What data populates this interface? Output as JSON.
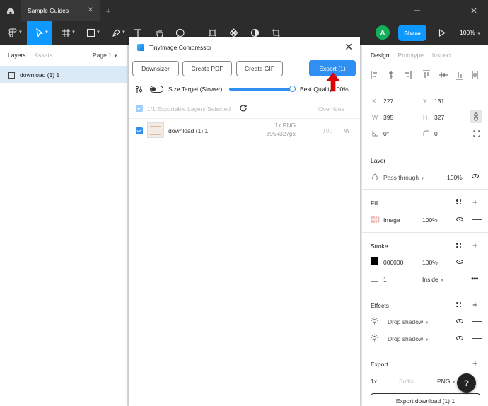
{
  "tabbar": {
    "active_tab": "Sample Guides",
    "close_glyph": "✕",
    "plus_glyph": "+"
  },
  "toolbar": {
    "avatar_initial": "A",
    "share_label": "Share",
    "zoom": "100%"
  },
  "left_panel": {
    "tabs": [
      "Layers",
      "Assets"
    ],
    "page_label": "Page 1",
    "layer_name": "download (1) 1"
  },
  "plugin": {
    "title": "TinyImage Compressor",
    "buttons": [
      "Downsizer",
      "Create PDF",
      "Create GIF"
    ],
    "export_label": "Export (1)",
    "size_target_label": "Size Target (Slower)",
    "best_quality_label": "Best Quality",
    "quality_value": "100%",
    "selected_label": "1/1 Exportable Layers Selected",
    "overrides_label": "Overrides",
    "item": {
      "name": "download (1) 1",
      "format": "1x PNG",
      "dimensions": "395x327px",
      "quality_placeholder": "100",
      "percent_sign": "%"
    }
  },
  "right_panel": {
    "tabs": [
      "Design",
      "Prototype",
      "Inspect"
    ],
    "position": {
      "x_label": "X",
      "x": "227",
      "y_label": "Y",
      "y": "131"
    },
    "size": {
      "w_label": "W",
      "w": "395",
      "h_label": "H",
      "h": "327"
    },
    "rotation": "0°",
    "radius": "0",
    "layer": {
      "heading": "Layer",
      "blend": "Pass through",
      "opacity": "100%"
    },
    "fill": {
      "heading": "Fill",
      "type": "Image",
      "opacity": "100%"
    },
    "stroke": {
      "heading": "Stroke",
      "color": "000000",
      "opacity": "100%",
      "weight": "1",
      "position": "Inside"
    },
    "effects": {
      "heading": "Effects",
      "items": [
        "Drop shadow",
        "Drop shadow"
      ]
    },
    "export": {
      "heading": "Export",
      "scale": "1x",
      "suffix_placeholder": "Suffix",
      "format": "PNG",
      "button_label": "Export download (1) 1"
    }
  },
  "help_label": "?",
  "colors": {
    "accent": "#0d99ff",
    "plugin_blue": "#2f8ff3",
    "toolbar_bg": "#2c2c2c",
    "annotation_arrow": "#e30000"
  }
}
